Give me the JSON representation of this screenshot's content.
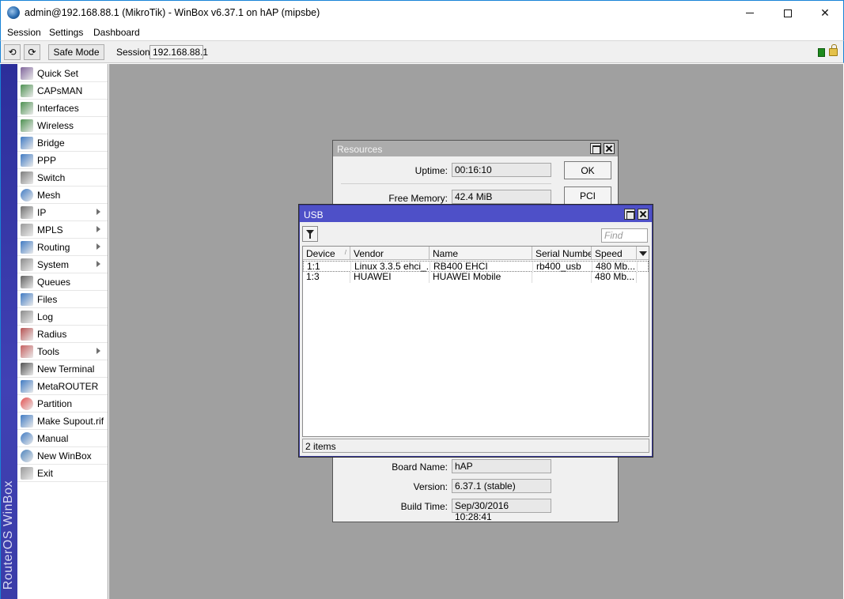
{
  "window": {
    "title": "admin@192.168.88.1 (MikroTik) - WinBox v6.37.1 on hAP (mipsbe)",
    "controls": {
      "minimize": "minimize",
      "maximize": "maximize",
      "close": "✕"
    }
  },
  "menubar": {
    "session": "Session",
    "settings": "Settings",
    "dashboard": "Dashboard"
  },
  "toolbar": {
    "undo": "⟲",
    "redo": "⟳",
    "safe_mode": "Safe Mode",
    "session_label": "Session:",
    "session_value": "192.168.88.1"
  },
  "brand": {
    "text": "RouterOS WinBox"
  },
  "sidebar": {
    "items": [
      {
        "label": "Quick Set",
        "icon": "wand-icon",
        "submenu": false
      },
      {
        "label": "CAPsMAN",
        "icon": "antenna-icon",
        "submenu": false
      },
      {
        "label": "Interfaces",
        "icon": "interfaces-icon",
        "submenu": false
      },
      {
        "label": "Wireless",
        "icon": "antenna-icon",
        "submenu": false
      },
      {
        "label": "Bridge",
        "icon": "bridge-icon",
        "submenu": false
      },
      {
        "label": "PPP",
        "icon": "ppp-icon",
        "submenu": false
      },
      {
        "label": "Switch",
        "icon": "switch-icon",
        "submenu": false
      },
      {
        "label": "Mesh",
        "icon": "mesh-icon",
        "submenu": false
      },
      {
        "label": "IP",
        "icon": "ip-icon",
        "submenu": true
      },
      {
        "label": "MPLS",
        "icon": "mpls-icon",
        "submenu": true
      },
      {
        "label": "Routing",
        "icon": "routing-icon",
        "submenu": true
      },
      {
        "label": "System",
        "icon": "gear-icon",
        "submenu": true
      },
      {
        "label": "Queues",
        "icon": "queues-icon",
        "submenu": false
      },
      {
        "label": "Files",
        "icon": "folder-icon",
        "submenu": false
      },
      {
        "label": "Log",
        "icon": "log-icon",
        "submenu": false
      },
      {
        "label": "Radius",
        "icon": "users-icon",
        "submenu": false
      },
      {
        "label": "Tools",
        "icon": "tools-icon",
        "submenu": true
      },
      {
        "label": "New Terminal",
        "icon": "terminal-icon",
        "submenu": false
      },
      {
        "label": "MetaROUTER",
        "icon": "metarouter-icon",
        "submenu": false
      },
      {
        "label": "Partition",
        "icon": "pie-icon",
        "submenu": false
      },
      {
        "label": "Make Supout.rif",
        "icon": "document-icon",
        "submenu": false
      },
      {
        "label": "Manual",
        "icon": "help-icon",
        "submenu": false
      },
      {
        "label": "New WinBox",
        "icon": "winbox-icon",
        "submenu": false
      },
      {
        "label": "Exit",
        "icon": "exit-icon",
        "submenu": false
      }
    ]
  },
  "resources": {
    "title": "Resources",
    "ok": "OK",
    "pci": "PCI",
    "uptime_label": "Uptime:",
    "uptime_value": "00:16:10",
    "free_memory_label": "Free Memory:",
    "free_memory_value": "42.4 MiB",
    "board_name_label": "Board Name:",
    "board_name_value": "hAP",
    "version_label": "Version:",
    "version_value": "6.37.1 (stable)",
    "build_time_label": "Build Time:",
    "build_time_value": "Sep/30/2016 10:28:41"
  },
  "usb": {
    "title": "USB",
    "find_placeholder": "Find",
    "columns": [
      "Device",
      "Vendor",
      "Name",
      "Serial Number",
      "Speed"
    ],
    "sort_indicator": "/",
    "rows": [
      [
        "1:1",
        "Linux 3.3.5 ehci_...",
        "RB400 EHCI",
        "rb400_usb",
        "480 Mb..."
      ],
      [
        "1:3",
        "HUAWEI",
        "HUAWEI Mobile",
        "",
        "480 Mb..."
      ]
    ],
    "status": "2 items"
  }
}
